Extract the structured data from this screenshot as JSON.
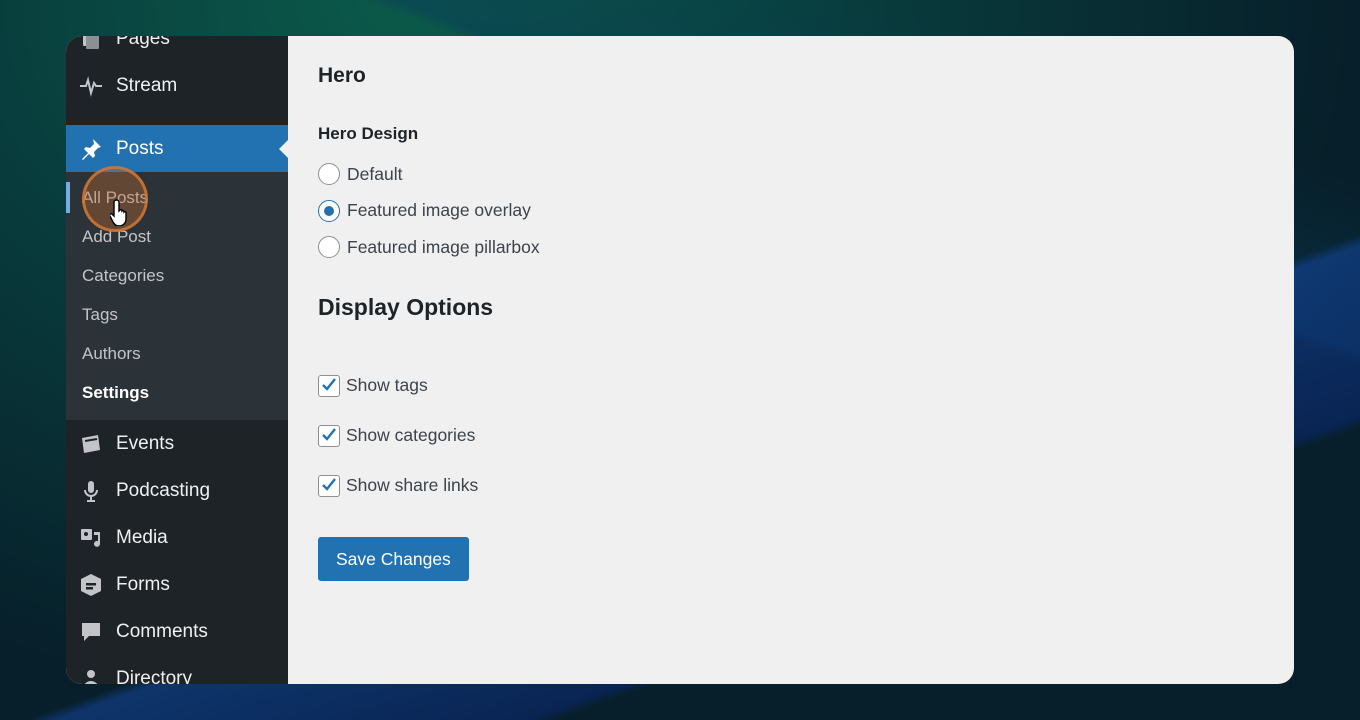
{
  "sidebar": {
    "top_items": [
      {
        "label": "Pages",
        "icon": "pages-icon"
      },
      {
        "label": "Stream",
        "icon": "pulse-icon"
      }
    ],
    "active_item": {
      "label": "Posts",
      "icon": "pushpin-icon"
    },
    "submenu": [
      {
        "label": "All Posts"
      },
      {
        "label": "Add Post"
      },
      {
        "label": "Categories"
      },
      {
        "label": "Tags"
      },
      {
        "label": "Authors"
      },
      {
        "label": "Settings"
      }
    ],
    "bottom_items": [
      {
        "label": "Events",
        "icon": "calendar-icon"
      },
      {
        "label": "Podcasting",
        "icon": "microphone-icon"
      },
      {
        "label": "Media",
        "icon": "media-icon"
      },
      {
        "label": "Forms",
        "icon": "forms-icon"
      },
      {
        "label": "Comments",
        "icon": "comment-icon"
      },
      {
        "label": "Directory",
        "icon": "person-icon"
      }
    ]
  },
  "main": {
    "section_title": "Hero",
    "hero_design_label": "Hero Design",
    "radio_options": [
      {
        "label": "Default",
        "checked": false
      },
      {
        "label": "Featured image overlay",
        "checked": true
      },
      {
        "label": "Featured image pillarbox",
        "checked": false
      }
    ],
    "display_title": "Display Options",
    "checkboxes": [
      {
        "label": "Show tags",
        "checked": true
      },
      {
        "label": "Show categories",
        "checked": true
      },
      {
        "label": "Show share links",
        "checked": true
      }
    ],
    "save_label": "Save Changes"
  },
  "colors": {
    "accent": "#2271b1",
    "sidebar_bg": "#1d2327",
    "submenu_bg": "#2c3338",
    "content_bg": "#f0f0f1"
  }
}
